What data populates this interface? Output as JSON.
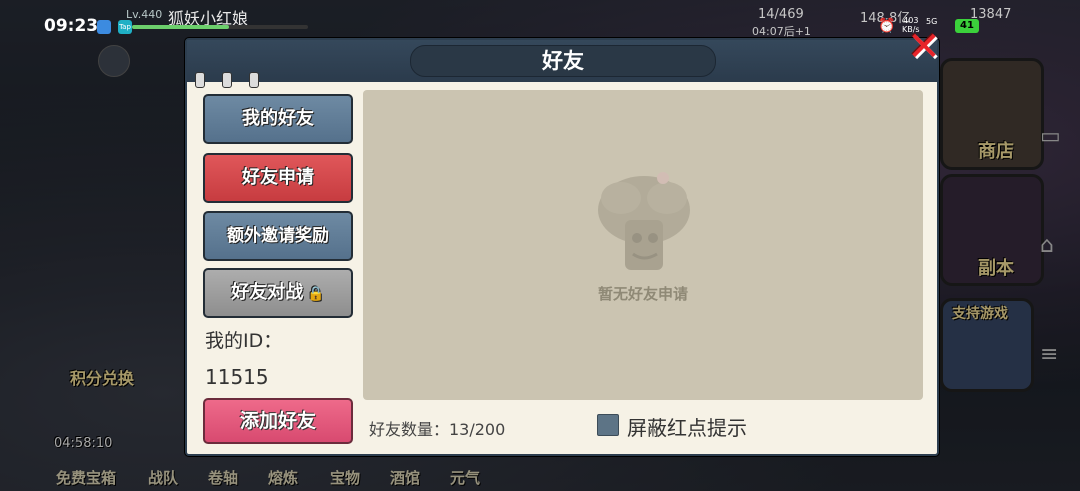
{
  "status_bar": {
    "time": "09:23",
    "app_badge": "Tap",
    "player_level": "Lv.440",
    "player_name": "狐妖小红娘",
    "xp_progress": 0.55,
    "energy": "14/469",
    "energy_timer": "04:07后+1",
    "gold": "148.8亿",
    "gems": "13847",
    "net_speed": "403\nKB/s",
    "network": "5G",
    "battery": "41"
  },
  "dialog": {
    "title": "好友",
    "close_symbol": "✕",
    "tabs": [
      {
        "label": "我的好友",
        "style": "blue"
      },
      {
        "label": "好友申请",
        "style": "red",
        "selected": true
      },
      {
        "label": "额外邀请奖励",
        "style": "blue"
      },
      {
        "label": "好友对战",
        "style": "grey",
        "locked": true
      }
    ],
    "my_id_label": "我的ID：",
    "my_id_value": "11515",
    "add_friend_button": "添加好友",
    "empty_message": "暂无好友申请",
    "friend_count": "好友数量：13/200",
    "mute_red_dot_label": "屏蔽红点提示",
    "mute_red_dot_checked": true
  },
  "background": {
    "side_labels": [
      "商店",
      "副本",
      "支持游戏"
    ],
    "left_labels": [
      "积分兑换"
    ],
    "timer": "04:58:10",
    "bottom_labels": [
      "免费宝箱",
      "战队",
      "卷轴",
      "熔炼",
      "宝物",
      "酒馆",
      "元气"
    ]
  },
  "colors": {
    "dialog_bg": "#f6f2e6",
    "header_bg": "#2b3b4c",
    "tab_blue": "#5f7b95",
    "tab_red": "#d04548",
    "tab_grey": "#9c9c9c",
    "add_button": "#e25a7c",
    "panel_bg": "#cbc4b1"
  }
}
